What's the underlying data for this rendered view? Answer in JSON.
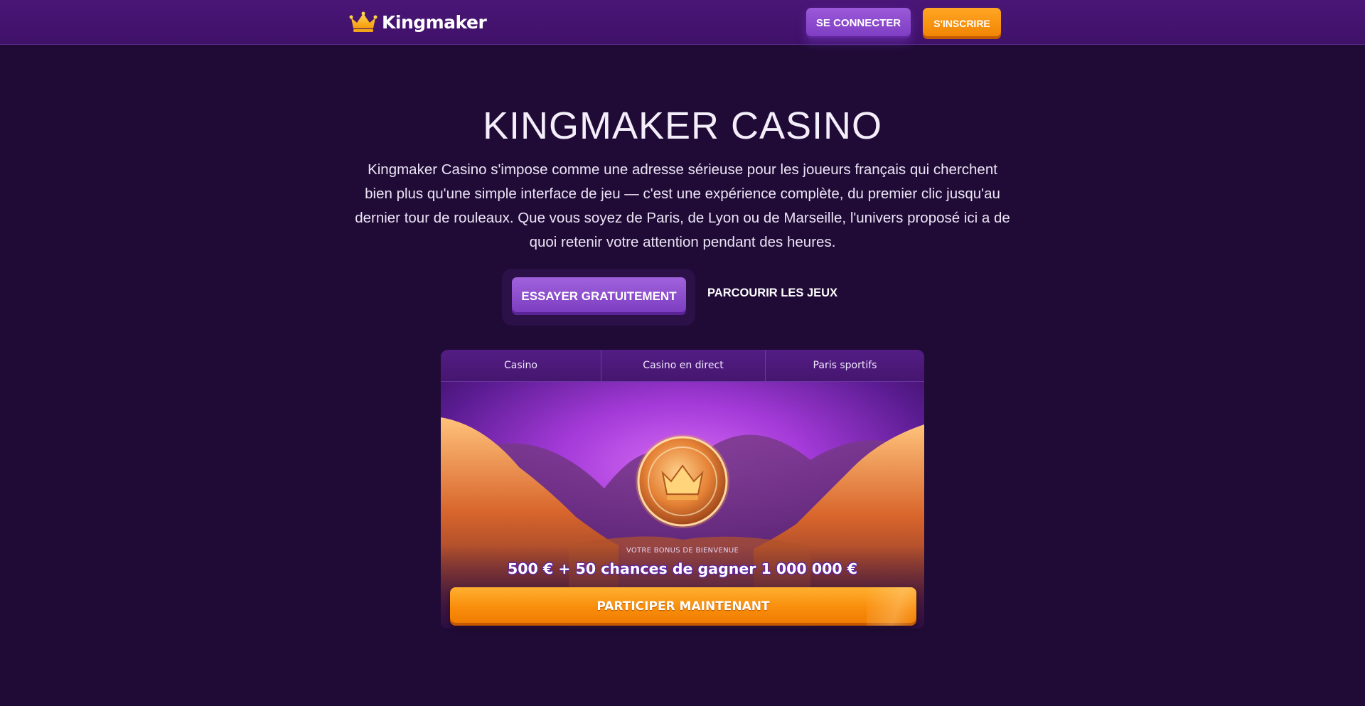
{
  "header": {
    "logo_text": "Kingmaker",
    "logo_icon": "crown-icon",
    "login_label": "SE CONNECTER",
    "signup_label": "S'INSCRIRE"
  },
  "hero": {
    "title": "KINGMAKER CASINO",
    "text": "Kingmaker Casino s'impose comme une adresse sérieuse pour les joueurs français qui cherchent bien plus qu'une simple interface de jeu — c'est une expérience complète, du premier clic jusqu'au dernier tour de rouleaux. Que vous soyez de Paris, de Lyon ou de Marseille, l'univers proposé ici a de quoi retenir votre attention pendant des heures.",
    "primary_cta": "ESSAYER GRATUITEMENT",
    "secondary_cta": "PARCOURIR LES JEUX"
  },
  "promo": {
    "tabs": [
      {
        "label": "Casino"
      },
      {
        "label": "Casino en direct"
      },
      {
        "label": "Paris sportifs"
      }
    ],
    "art_icon": "crown-coin-icon",
    "bonus_label": "VOTRE BONUS DE BIENVENUE",
    "bonus_amount": "500 € + 50 chances de gagner 1 000 000 €",
    "cta": "PARTICIPER MAINTENANT"
  },
  "colors": {
    "background": "#200b36",
    "header": "#4a1677",
    "accent_purple": "#8a47cf",
    "accent_orange": "#f98c0a"
  }
}
